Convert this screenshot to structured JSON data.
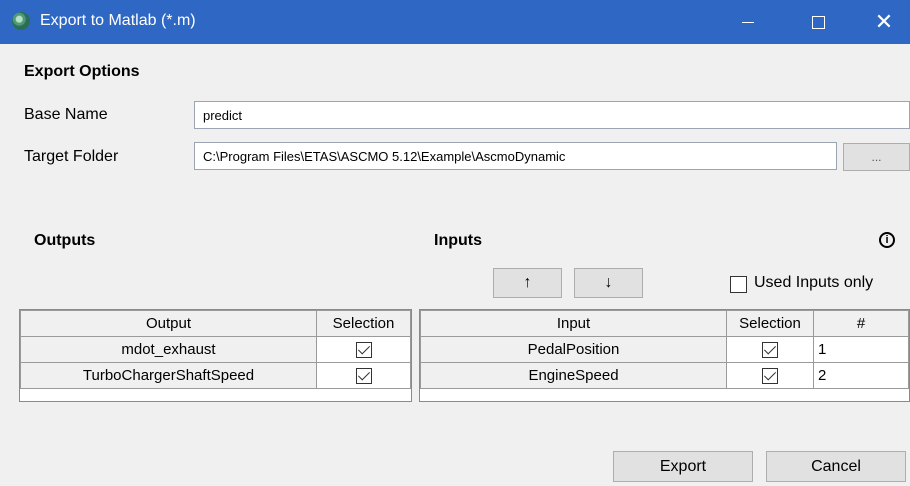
{
  "window": {
    "title": "Export to Matlab (*.m)",
    "icon": "ascmo-app-icon"
  },
  "section_title": "Export Options",
  "base_name": {
    "label": "Base Name",
    "value": "predict"
  },
  "target_folder": {
    "label": "Target Folder",
    "value": "C:\\Program Files\\ETAS\\ASCMO 5.12\\Example\\AscmoDynamic",
    "browse_label": "..."
  },
  "outputs": {
    "title": "Outputs",
    "columns": [
      "Output",
      "Selection"
    ],
    "rows": [
      {
        "name": "mdot_exhaust",
        "selected": true
      },
      {
        "name": "TurboChargerShaftSpeed",
        "selected": true
      }
    ]
  },
  "inputs": {
    "title": "Inputs",
    "move_up_label": "↑",
    "move_down_label": "↓",
    "used_only_label": "Used Inputs only",
    "used_only_checked": false,
    "info_icon": "info-icon",
    "columns": [
      "Input",
      "Selection",
      "#"
    ],
    "rows": [
      {
        "name": "PedalPosition",
        "selected": true,
        "index": "1"
      },
      {
        "name": "EngineSpeed",
        "selected": true,
        "index": "2"
      }
    ]
  },
  "buttons": {
    "export": "Export",
    "cancel": "Cancel"
  },
  "colors": {
    "titlebar": "#2f67c4",
    "background": "#f0f0f0"
  }
}
